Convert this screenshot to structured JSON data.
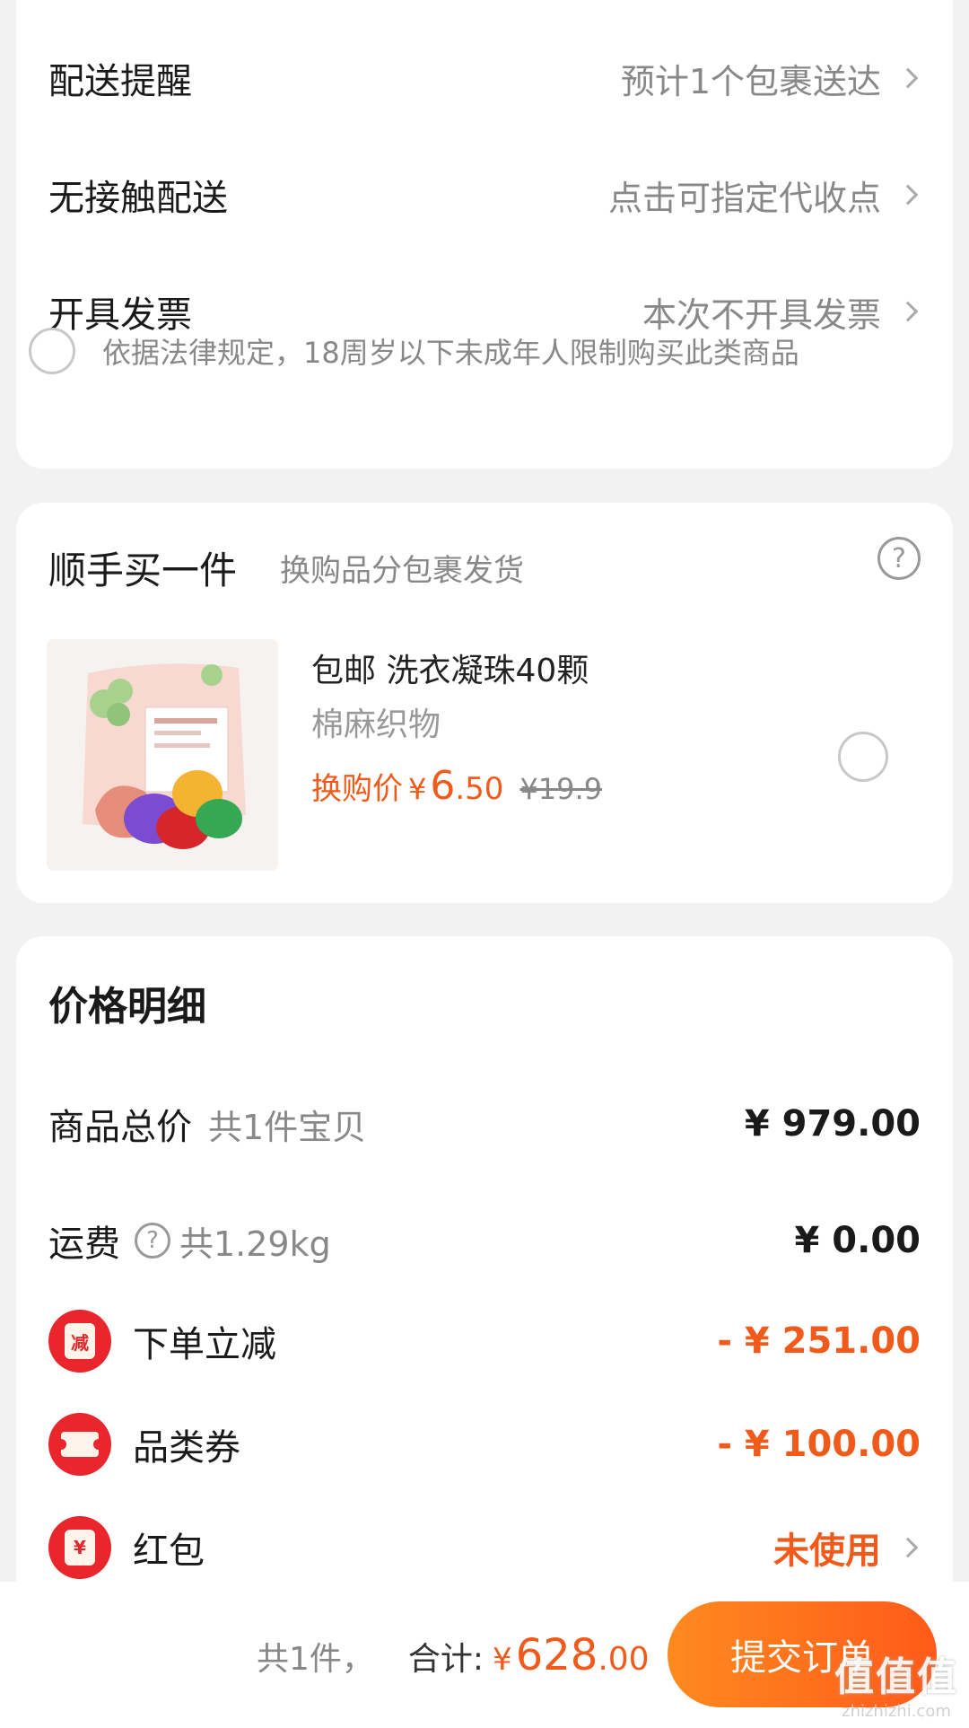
{
  "delivery": {
    "rows": [
      {
        "label": "配送提醒",
        "value": "预计1个包裹送达"
      },
      {
        "label": "无接触配送",
        "value": "点击可指定代收点"
      },
      {
        "label": "开具发票",
        "value": "本次不开具发票"
      }
    ],
    "legal_notice": "依据法律规定，18周岁以下未成年人限制购买此类商品"
  },
  "addon": {
    "title": "顺手买一件",
    "subtitle": "换购品分包裹发货",
    "help_glyph": "?",
    "product": {
      "name": "包邮 洗衣凝珠40颗",
      "variant": "棉麻织物",
      "price_label": "换购价",
      "currency": "¥",
      "price_int": "6",
      "price_dec": ".50",
      "original_price": "¥19.9"
    }
  },
  "price_detail": {
    "title": "价格明细",
    "rows": [
      {
        "label": "商品总价",
        "sub": "共1件宝贝",
        "value": "¥ 979.00"
      },
      {
        "label": "运费",
        "sub": "共1.29kg",
        "value": "¥ 0.00"
      },
      {
        "label": "下单立减",
        "badge": "减",
        "value": "- ¥ 251.00"
      },
      {
        "label": "品类券",
        "value": "- ¥ 100.00"
      },
      {
        "label": "红包",
        "badge": "¥",
        "value": "未使用"
      }
    ]
  },
  "bottom_bar": {
    "count": "共1件，",
    "total_label": "合计:",
    "currency": "¥",
    "total_int": "628",
    "total_dec": ".00",
    "submit": "提交订单"
  },
  "watermark": {
    "logo": "值值值",
    "url": "zhizhizhi.com"
  },
  "colors": {
    "accent": "#f05a1a",
    "badge_red": "#e8262b",
    "background": "#f2f2f2"
  }
}
